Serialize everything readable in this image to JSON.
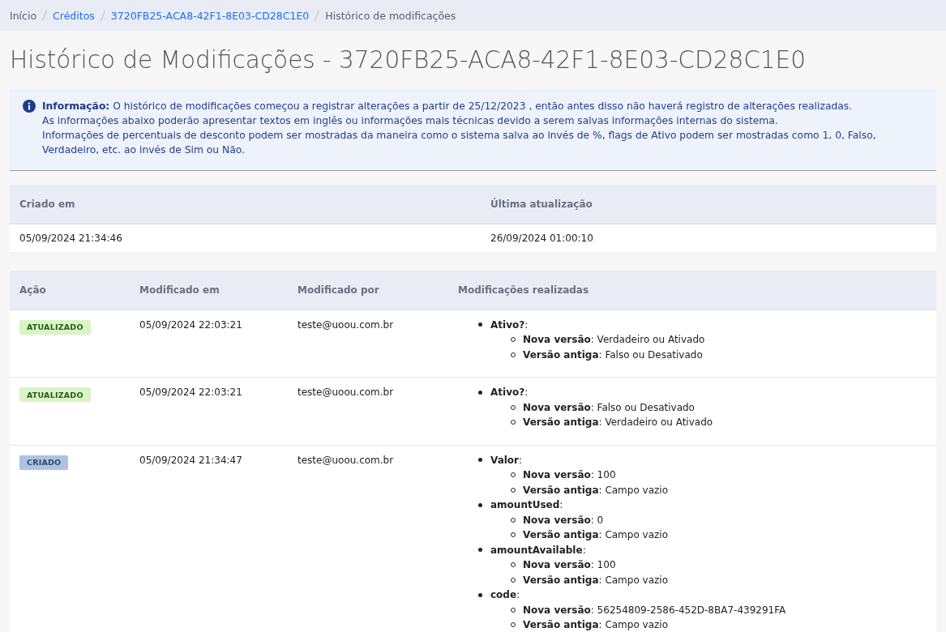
{
  "breadcrumb": [
    {
      "label": "Início",
      "link": false
    },
    {
      "label": "Créditos",
      "link": true
    },
    {
      "label": "3720FB25-ACA8-42F1-8E03-CD28C1E0",
      "link": true
    },
    {
      "label": "Histórico de modificações",
      "link": false
    }
  ],
  "title": "Histórico de Modificações - 3720FB25-ACA8-42F1-8E03-CD28C1E0",
  "info": {
    "lines": [
      "**Informação:**  O histórico de modificações começou a registrar alterações a partir de 25/12/2023 , então antes disso não haverá registro de alterações realizadas.",
      "As informações abaixo poderão apresentar textos em inglês ou informações mais técnicas devido a serem salvas informações internas do sistema.",
      "Informações de percentuais de desconto podem ser mostradas da maneira como o sistema salva ao invés de %, flags de Ativo podem ser mostradas como 1, 0, Falso, Verdadeiro, etc. ao invés de Sim ou Não."
    ]
  },
  "summary": {
    "columns": [
      "Criado em",
      "Última atualização"
    ],
    "rows": [
      [
        "05/09/2024 21:34:46",
        "26/09/2024 01:00:10"
      ]
    ]
  },
  "history": {
    "columns": [
      "Ação",
      "Modificado em",
      "Modificado por",
      "Modificações realizadas"
    ],
    "rows": [
      {
        "action": {
          "label": "ATUALIZADO",
          "kind": "updated"
        },
        "modified_at": "05/09/2024 22:03:21",
        "modified_by": "teste@uoou.com.br",
        "changes": [
          {
            "text": "**Ativo?**:",
            "children": [
              "**Nova versão**: Verdadeiro ou Ativado",
              "**Versão antiga**: Falso ou Desativado"
            ]
          }
        ]
      },
      {
        "action": {
          "label": "ATUALIZADO",
          "kind": "updated"
        },
        "modified_at": "05/09/2024 22:03:21",
        "modified_by": "teste@uoou.com.br",
        "changes": [
          {
            "text": "**Ativo?**:",
            "children": [
              "**Nova versão**: Falso ou Desativado",
              "**Versão antiga**: Verdadeiro ou Ativado"
            ]
          }
        ]
      },
      {
        "action": {
          "label": "CRIADO",
          "kind": "created"
        },
        "modified_at": "05/09/2024 21:34:47",
        "modified_by": "teste@uoou.com.br",
        "changes": [
          {
            "text": "**Valor**:",
            "children": [
              "**Nova versão**: 100",
              "**Versão antiga**: Campo vazio"
            ]
          },
          {
            "text": "**amountUsed**:",
            "children": [
              "**Nova versão**: 0",
              "**Versão antiga**: Campo vazio"
            ]
          },
          {
            "text": "**amountAvailable**:",
            "children": [
              "**Nova versão**: 100",
              "**Versão antiga**: Campo vazio"
            ]
          },
          {
            "text": "**code**:",
            "children": [
              "**Nova versão**: 56254809-2586-452D-8BA7-439291FA",
              "**Versão antiga**: Campo vazio"
            ]
          }
        ]
      }
    ]
  }
}
